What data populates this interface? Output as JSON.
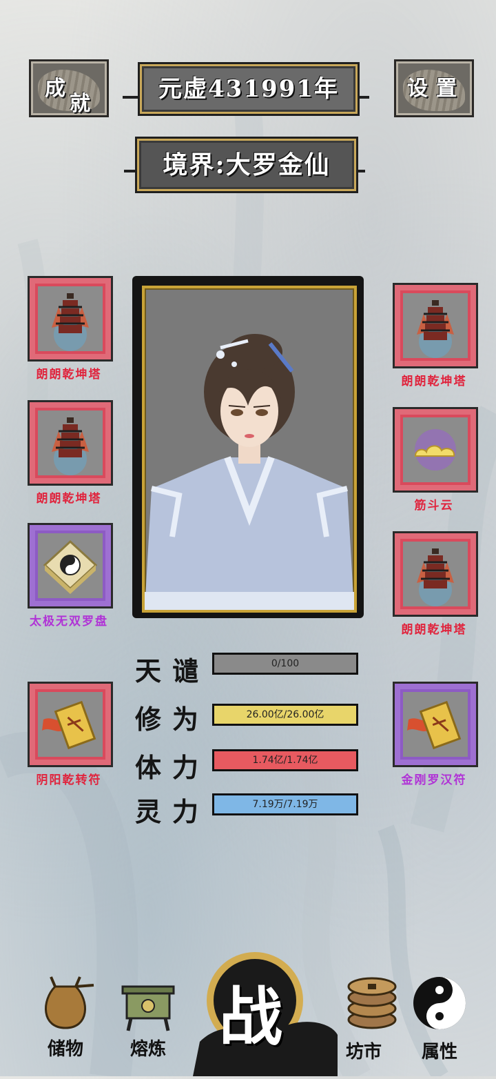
{
  "header": {
    "achievements_label_1": "成",
    "achievements_label_2": "就",
    "settings_label_1": "设",
    "settings_label_2": "置",
    "year": "元虚431991年",
    "realm": "境界:大罗金仙"
  },
  "left_slots": [
    {
      "name": "朗朗乾坤塔",
      "icon": "pagoda-icon",
      "rarity": "red"
    },
    {
      "name": "朗朗乾坤塔",
      "icon": "pagoda-icon",
      "rarity": "red"
    },
    {
      "name": "太极无双罗盘",
      "icon": "compass-icon",
      "rarity": "purple"
    },
    {
      "name": "阴阳乾转符",
      "icon": "talisman-icon",
      "rarity": "red"
    }
  ],
  "right_slots": [
    {
      "name": "朗朗乾坤塔",
      "icon": "pagoda-icon",
      "rarity": "red"
    },
    {
      "name": "筋斗云",
      "icon": "cloud-icon",
      "rarity": "red"
    },
    {
      "name": "朗朗乾坤塔",
      "icon": "pagoda-icon",
      "rarity": "red"
    },
    {
      "name": "金刚罗汉符",
      "icon": "talisman-icon",
      "rarity": "purple"
    }
  ],
  "stats": [
    {
      "label": "天谴",
      "value": "0/100",
      "fill": 0.0,
      "color": "#8a8a8a"
    },
    {
      "label": "修为",
      "value": "26.00亿/26.00亿",
      "fill": 1.0,
      "color": "#e8d56a"
    },
    {
      "label": "体力",
      "value": "1.74亿/1.74亿",
      "fill": 1.0,
      "color": "#e85a60"
    },
    {
      "label": "灵力",
      "value": "7.19万/7.19万",
      "fill": 1.0,
      "color": "#7fb7e6"
    }
  ],
  "nav": {
    "storage": "储物",
    "smelt": "熔炼",
    "battle": "战",
    "market": "坊市",
    "attributes": "属性"
  },
  "colors": {
    "red_rarity": "#e0243d",
    "purple_rarity": "#b033d6"
  }
}
